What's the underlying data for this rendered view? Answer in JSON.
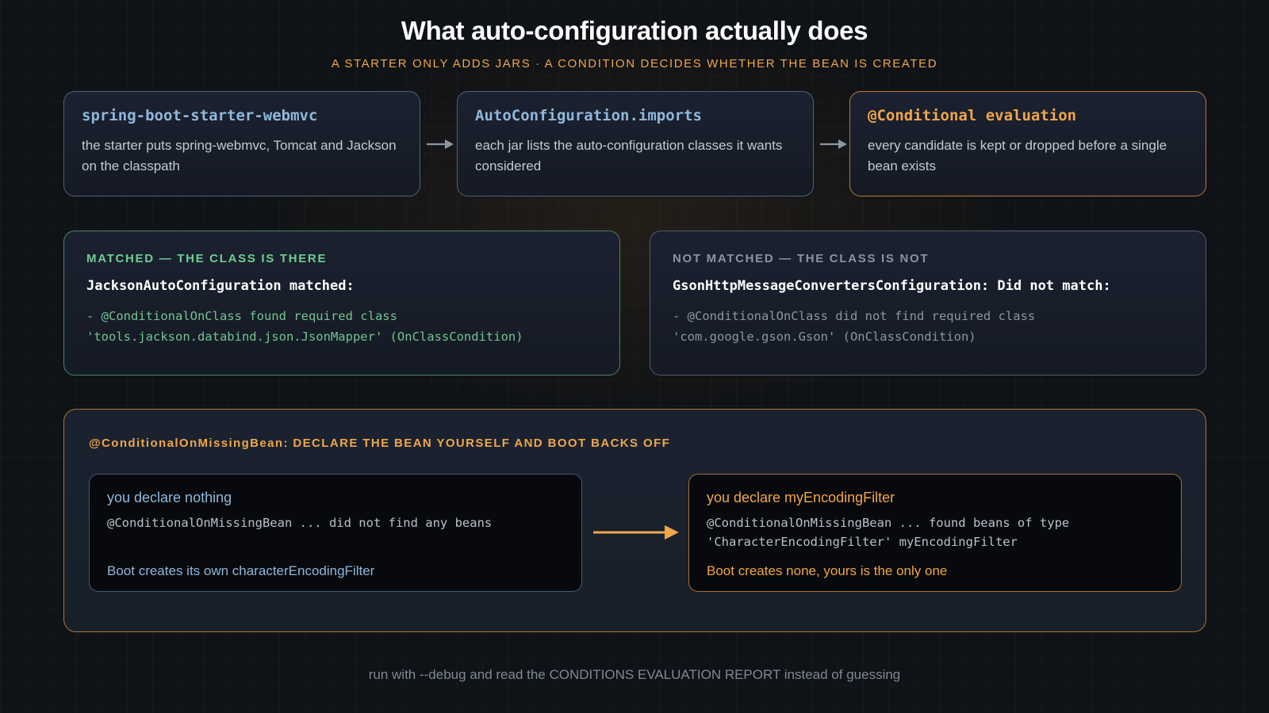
{
  "title": "What auto-configuration actually does",
  "subtitle": "A STARTER ONLY ADDS JARS · A CONDITION DECIDES WHETHER THE BEAN IS CREATED",
  "steps": [
    {
      "title": "spring-boot-starter-webmvc",
      "desc": "the starter puts spring-webmvc, Tomcat and Jackson on the classpath"
    },
    {
      "title": "AutoConfiguration.imports",
      "desc": "each jar lists the auto-configuration classes it wants considered"
    },
    {
      "title": "@Conditional evaluation",
      "desc": "every candidate is kept or dropped before a single bean exists"
    }
  ],
  "matched": {
    "label": "MATCHED — THE CLASS IS THERE",
    "heading": "JacksonAutoConfiguration matched:",
    "lines": [
      "- @ConditionalOnClass found required class",
      "'tools.jackson.databind.json.JsonMapper' (OnClassCondition)"
    ]
  },
  "not_matched": {
    "label": "NOT MATCHED — THE CLASS IS NOT",
    "heading": "GsonHttpMessageConvertersConfiguration: Did not match:",
    "lines": [
      "- @ConditionalOnClass did not find required class",
      "'com.google.gson.Gson' (OnClassCondition)"
    ]
  },
  "backoff": {
    "label": "@ConditionalOnMissingBean: DECLARE THE BEAN YOURSELF AND BOOT BACKS OFF",
    "left": {
      "title": "you declare nothing",
      "code": [
        "@ConditionalOnMissingBean ... did not find any beans"
      ],
      "result": "Boot creates its own characterEncodingFilter"
    },
    "right": {
      "title": "you declare myEncodingFilter",
      "code": [
        "@ConditionalOnMissingBean ... found beans of type",
        "'CharacterEncodingFilter' myEncodingFilter"
      ],
      "result": "Boot creates none, yours is the only one"
    }
  },
  "footer": "run with --debug and read the CONDITIONS EVALUATION REPORT instead of guessing",
  "colors": {
    "accent_orange": "#f0a64a",
    "accent_blue": "#8fb8dc",
    "accent_green": "#6fce92",
    "muted_grey": "#8b94a2",
    "background": "#0f1216"
  }
}
